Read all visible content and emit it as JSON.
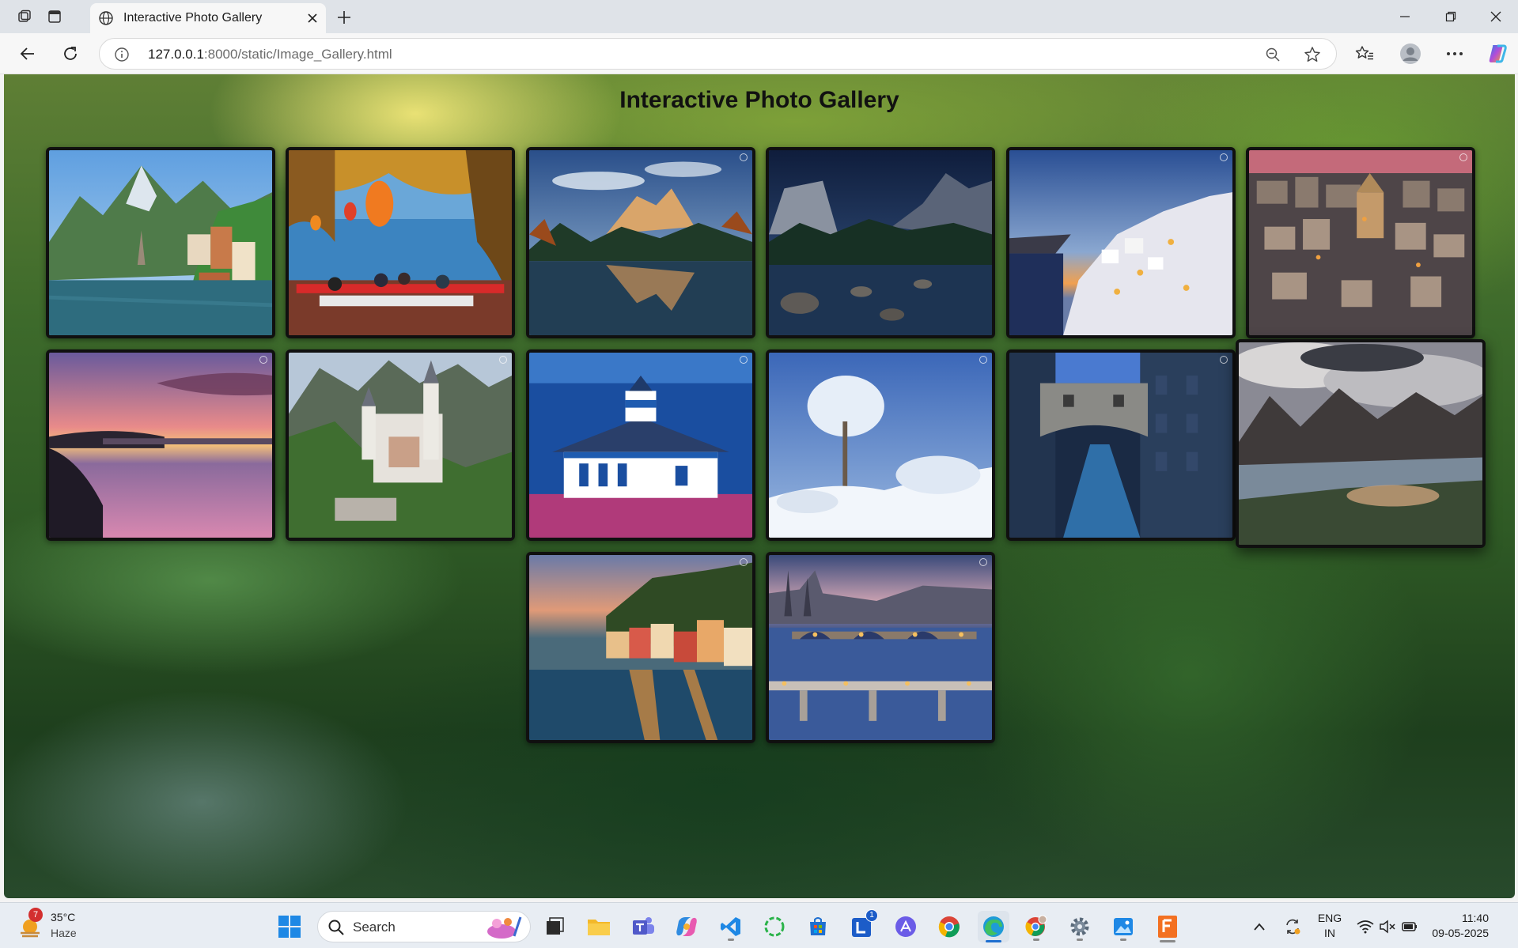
{
  "browser": {
    "tab_title": "Interactive Photo Gallery",
    "url_host": "127.0.0.1",
    "url_path": ":8000/static/Image_Gallery.html"
  },
  "page": {
    "title": "Interactive Photo Gallery",
    "photos": [
      {
        "name": "hallstatt-lake-village"
      },
      {
        "name": "lakeside-terrace-lanterns"
      },
      {
        "name": "mountain-lake-reflection"
      },
      {
        "name": "yosemite-river-night"
      },
      {
        "name": "santorini-sunset"
      },
      {
        "name": "hilltop-old-town-dusk"
      },
      {
        "name": "bridge-river-sunset"
      },
      {
        "name": "neuschwanstein-castle"
      },
      {
        "name": "blue-white-lighthouse"
      },
      {
        "name": "snowy-tree"
      },
      {
        "name": "bridge-of-sighs-venice"
      },
      {
        "name": "mountain-lake-storm"
      },
      {
        "name": "lakeside-colorful-village"
      },
      {
        "name": "prague-bridges-night"
      }
    ]
  },
  "taskbar": {
    "weather_temp": "35°C",
    "weather_desc": "Haze",
    "weather_badge": "7",
    "search_label": "Search",
    "l_badge": "1",
    "lang_line1": "ENG",
    "lang_line2": "IN",
    "time": "11:40",
    "date": "09-05-2025"
  }
}
